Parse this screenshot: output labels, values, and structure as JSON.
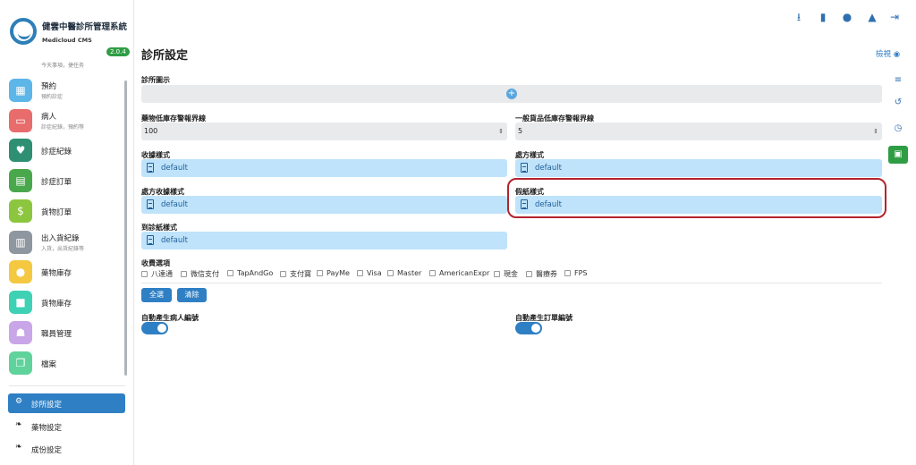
{
  "app": {
    "title": "健雲中醫診所管理系統",
    "subtitle": "Medicloud CMS",
    "version": "2.0.4"
  },
  "sidebar": {
    "partial_sub": "今天事項，捷任务",
    "items": [
      {
        "label": "預約",
        "sub": "預約診症",
        "icon": "calendar-icon",
        "color": "#5cb6e8"
      },
      {
        "label": "病人",
        "sub": "診症紀錄，預約等",
        "icon": "bed-icon",
        "color": "#e86c6c"
      },
      {
        "label": "診症紀錄",
        "sub": "",
        "icon": "stethoscope-icon",
        "color": "#2e8f73"
      },
      {
        "label": "診症訂單",
        "sub": "",
        "icon": "document-icon",
        "color": "#49a84c"
      },
      {
        "label": "貨物訂單",
        "sub": "",
        "icon": "invoice-icon",
        "color": "#8cc63f"
      },
      {
        "label": "出入貨紀錄",
        "sub": "入貨，出貨紀錄等",
        "icon": "warehouse-icon",
        "color": "#8e97a0"
      },
      {
        "label": "藥物庫存",
        "sub": "",
        "icon": "pills-icon",
        "color": "#f5c842"
      },
      {
        "label": "貨物庫存",
        "sub": "",
        "icon": "boxes-icon",
        "color": "#3fd1b4"
      },
      {
        "label": "職員管理",
        "sub": "",
        "icon": "staff-icon",
        "color": "#c9a6e8"
      },
      {
        "label": "檔案",
        "sub": "",
        "icon": "files-icon",
        "color": "#5fd39b"
      }
    ],
    "bottom": [
      {
        "label": "診所設定",
        "icon": "gears-icon",
        "active": true
      },
      {
        "label": "藥物設定",
        "icon": "leaf-icon",
        "active": false
      },
      {
        "label": "成份設定",
        "icon": "leaf-icon",
        "active": false
      }
    ]
  },
  "topbar": {
    "icons": [
      "download-icon",
      "clipboard-icon",
      "user-icon",
      "bell-icon",
      "logout-icon"
    ]
  },
  "page": {
    "title": "診所設定",
    "view_label": "檢視"
  },
  "right_tools": [
    "list-icon",
    "history-icon",
    "clock-icon",
    "save-icon"
  ],
  "form": {
    "clinic_icon_label": "診所圖示",
    "med_low_stock_label": "藥物低庫存警報界線",
    "med_low_stock_value": "100",
    "goods_low_stock_label": "一般貨品低庫存警報界線",
    "goods_low_stock_value": "5",
    "receipt_style_label": "收據樣式",
    "receipt_style_value": "default",
    "prescription_style_label": "處方樣式",
    "prescription_style_value": "default",
    "prescription_receipt_label": "處方收據樣式",
    "prescription_receipt_value": "default",
    "sick_leave_label": "假紙樣式",
    "sick_leave_value": "default",
    "attendance_label": "到診紙樣式",
    "attendance_value": "default",
    "payment_label": "收費選項",
    "payment_options": [
      "八達通",
      "微信支付",
      "TapAndGo",
      "支付寶",
      "PayMe",
      "Visa",
      "Master",
      "AmericanExpr",
      "現金",
      "醫療券",
      "FPS"
    ],
    "select_all": "全選",
    "clear": "清除",
    "auto_patient_label": "自動產生病人編號",
    "auto_order_label": "自動產生訂單編號"
  }
}
